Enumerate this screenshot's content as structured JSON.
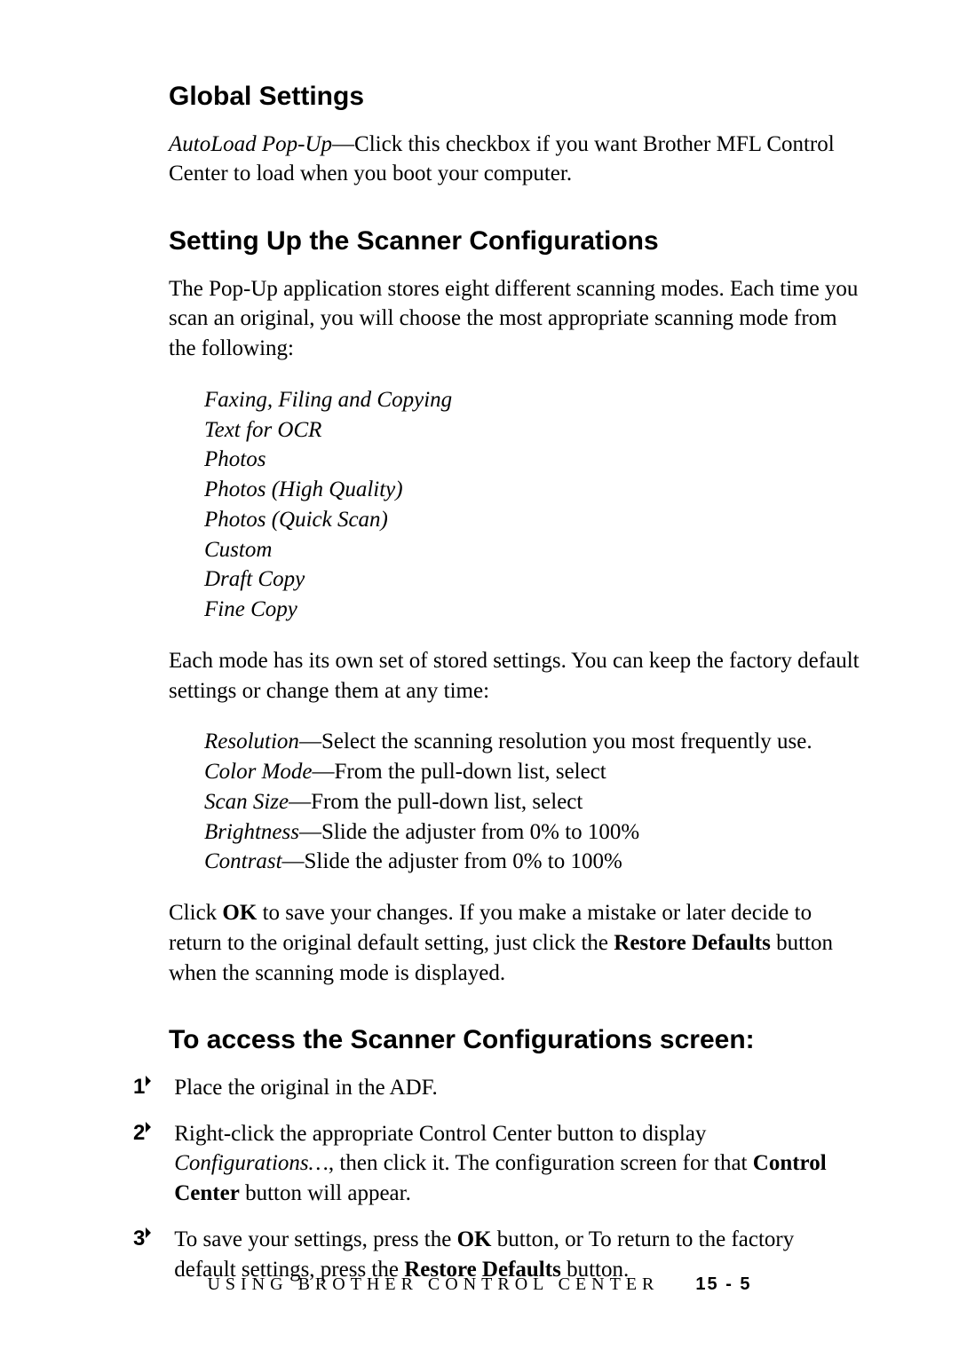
{
  "sections": {
    "global": {
      "heading": "Global Settings",
      "autoload_label": "AutoLoad Pop-Up",
      "autoload_text": "—Click this checkbox if you want Brother MFL Control Center to load when you boot your computer."
    },
    "scancfg": {
      "heading": "Setting Up the Scanner Configurations",
      "intro": "The Pop-Up application stores eight different scanning modes. Each time you scan an original, you will choose the most appropriate scanning mode from the following:",
      "modes": [
        "Faxing, Filing and Copying",
        "Text for OCR",
        "Photos",
        "Photos (High Quality)",
        "Photos (Quick Scan)",
        "Custom",
        "Draft Copy",
        "Fine Copy"
      ],
      "settings_intro": "Each mode has its own set of stored settings. You can keep the factory default settings or change them at any time:",
      "settings": [
        {
          "name": "Resolution",
          "desc": "—Select the scanning resolution you most frequently use."
        },
        {
          "name": "Color Mode",
          "desc": "—From the pull-down list, select"
        },
        {
          "name": "Scan Size",
          "desc": "—From the pull-down list, select"
        },
        {
          "name": "Brightness",
          "desc": "—Slide the adjuster from 0% to 100%"
        },
        {
          "name": "Contrast",
          "desc": "—Slide the adjuster from 0% to 100%"
        }
      ],
      "closing_pre": "Click ",
      "closing_ok": "OK",
      "closing_mid": " to save your changes. If you make a mistake or later decide to return to the original default setting, just click the ",
      "closing_restore": "Restore Defaults",
      "closing_post": " button when the scanning mode is displayed."
    },
    "access": {
      "heading": "To access the Scanner Configurations screen:",
      "step1": "Place the original in the ADF.",
      "step2_a": "Right-click the appropriate Control Center button to display ",
      "step2_b": "Configurations…",
      "step2_c": ", then click it. The configuration screen for that ",
      "step2_d": "Control Center",
      "step2_e": " button will appear.",
      "step3_a": "To save your settings, press the ",
      "step3_ok": "OK",
      "step3_b": " button, or To return to the factory default settings, press the ",
      "step3_restore": "Restore Defaults",
      "step3_c": " button."
    }
  },
  "footer": {
    "text": "USING BROTHER CONTROL CENTER",
    "page": "15 - 5"
  },
  "step_numbers": [
    "1",
    "2",
    "3"
  ]
}
